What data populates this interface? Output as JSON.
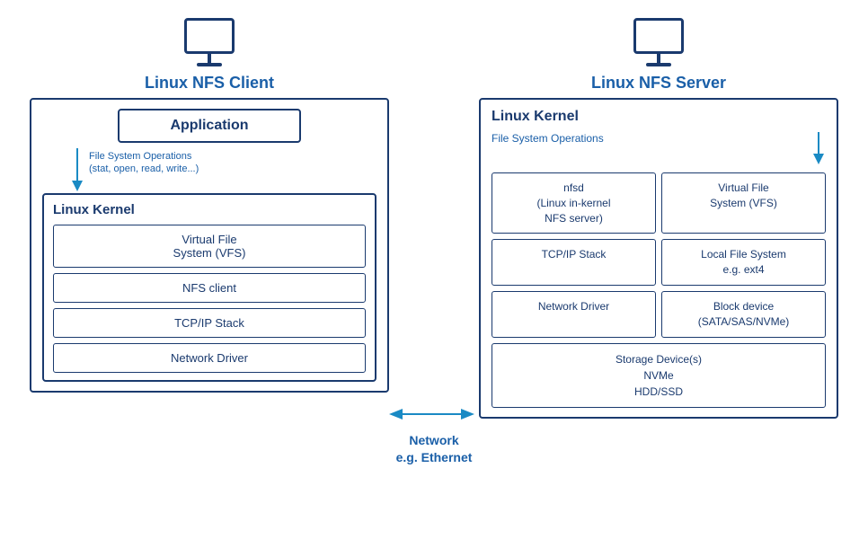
{
  "client": {
    "monitor_label": "Linux NFS Client",
    "app_label": "Application",
    "fs_ops_line1": "File System Operations",
    "fs_ops_line2": "(stat, open, read, write...)",
    "kernel_outer_label": "Linux Kernel",
    "stack": [
      "Virtual File\nSystem (VFS)",
      "NFS client",
      "TCP/IP Stack",
      "Network Driver"
    ]
  },
  "server": {
    "monitor_label": "Linux NFS Server",
    "kernel_label": "Linux Kernel",
    "fs_ops_label": "File System Operations",
    "grid": [
      {
        "text": "nfsd\n(Linux in-kernel\nNFS server)"
      },
      {
        "text": "Virtual File\nSystem (VFS)"
      },
      {
        "text": "TCP/IP Stack"
      },
      {
        "text": "Local File System\ne.g. ext4"
      },
      {
        "text": "Network Driver"
      },
      {
        "text": "Block device\n(SATA/SAS/NVMe)"
      }
    ],
    "storage_text": "Storage Device(s)\nNVMe\nHDD/SSD"
  },
  "network": {
    "line1": "Network",
    "line2": "e.g. Ethernet"
  },
  "colors": {
    "dark_blue": "#1a3a6e",
    "medium_blue": "#1a5fa8",
    "arrow_blue": "#1a8ac4"
  }
}
